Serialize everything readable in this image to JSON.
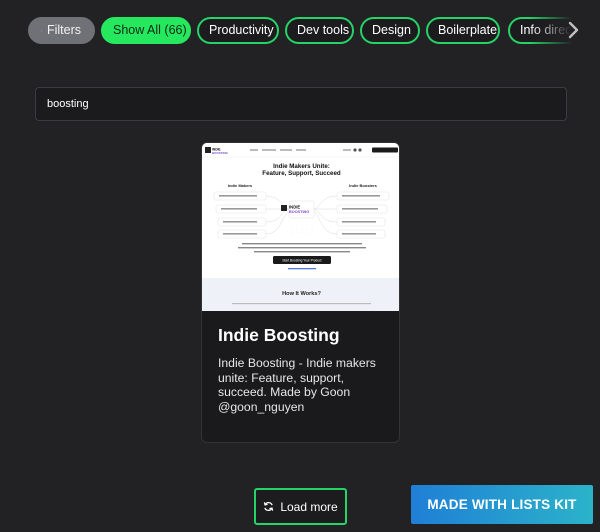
{
  "filters": {
    "filters_label": "Filters",
    "chips": [
      "Show All (66)",
      "Productivity",
      "Dev tools",
      "Design",
      "Boilerplate",
      "Info directories"
    ],
    "next_icon": "chevron-right-icon",
    "filter_icon": "sliders-icon"
  },
  "search": {
    "value": "boosting"
  },
  "card": {
    "title": "Indie Boosting",
    "description": "Indie Boosting - Indie makers unite: Feature, support, succeed. Made by Goon @goon_nguyen",
    "thumbnail": {
      "logo_line1": "INDIE",
      "logo_line2": "BOOSTING",
      "headline_1": "Indie Makers Unite:",
      "headline_2": "Feature, Support, Succeed",
      "left_heading": "Indie Makers",
      "right_heading": "Indie Boosters",
      "cta": "Start Boosting Your Product",
      "section_title": "How It Works?"
    }
  },
  "load_more": {
    "label": "Load more",
    "icon": "refresh-icon"
  },
  "badge": {
    "label": "MADE WITH LISTS KIT"
  },
  "colors": {
    "accent": "#25d366",
    "active_chip": "#25e85e",
    "background": "#222224"
  }
}
